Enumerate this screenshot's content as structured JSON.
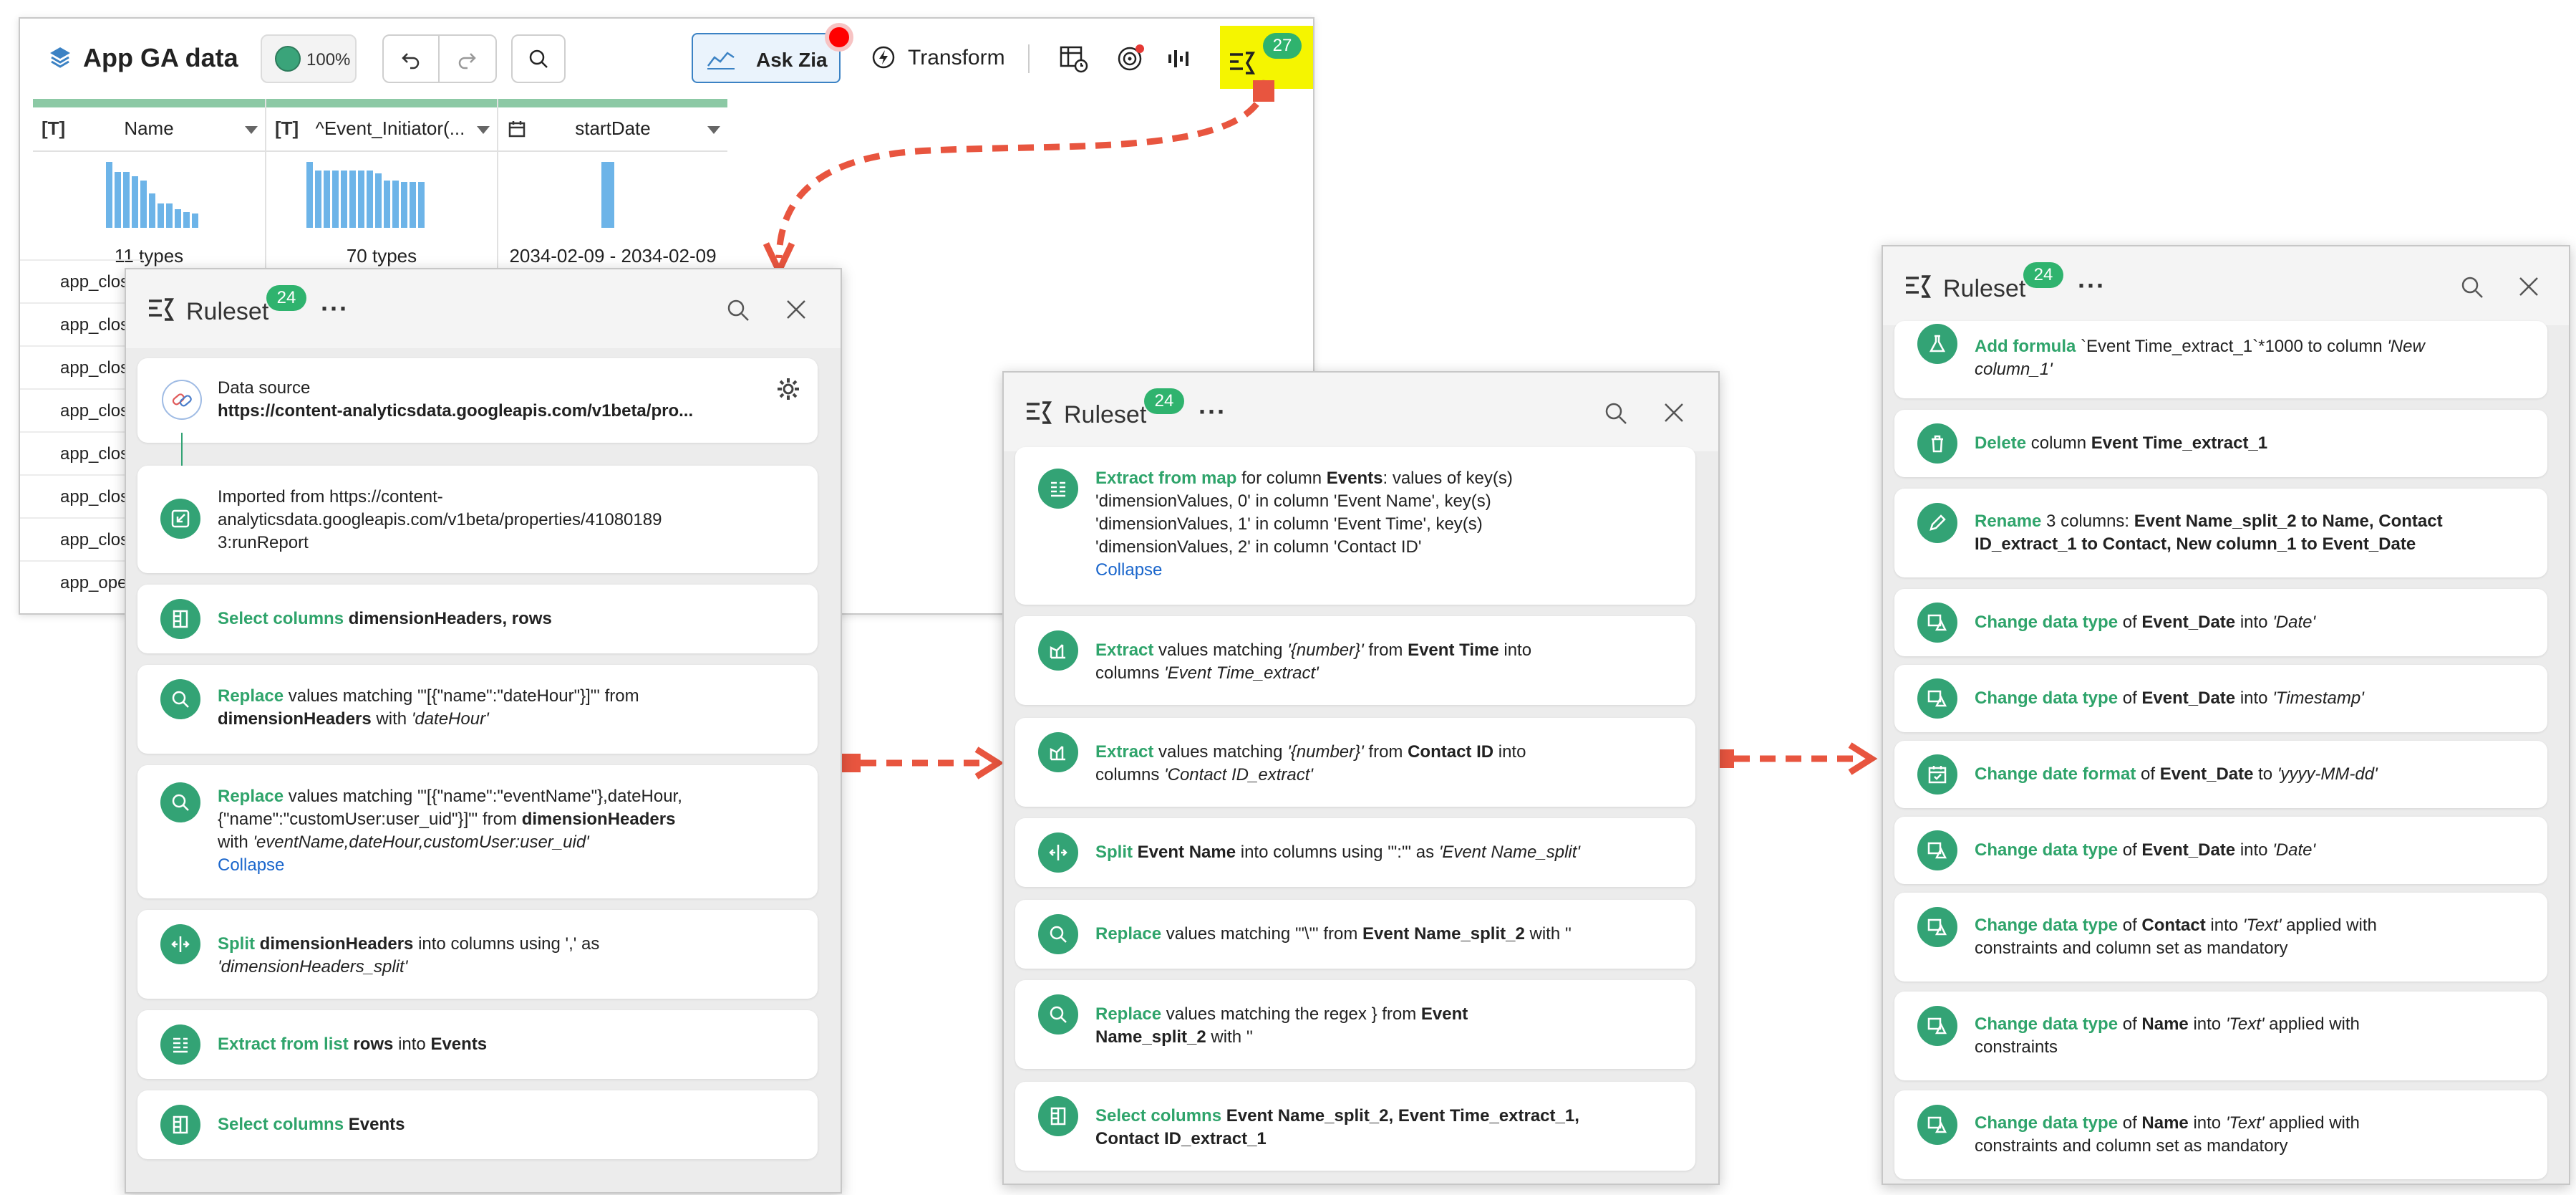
{
  "app": {
    "title": "App GA data",
    "zoom": "100%",
    "ask_zia_label": "Ask Zia",
    "transform_label": "Transform",
    "ruleset_badge": "27",
    "colors": {
      "accent_green": "#2fb36e",
      "action_green": "#2fa46b",
      "link_blue": "#1a66cc",
      "highlight_yellow": "#f5f500",
      "arrow_red": "#e8553f"
    },
    "columns": [
      {
        "type_icon": "[T]",
        "name": "Name",
        "summary": "11 types"
      },
      {
        "type_icon": "[T]",
        "name": "^Event_Initiator(...",
        "summary": "70 types"
      },
      {
        "type_icon": "calendar-icon",
        "name": "startDate",
        "summary": "2034-02-09 - 2034-02-09"
      }
    ],
    "rows": [
      "app_clos",
      "app_clos",
      "app_clos",
      "app_clos",
      "app_clos",
      "app_clos",
      "app_clos",
      "app_oper"
    ]
  },
  "panel1": {
    "title": "Ruleset",
    "badge": "24",
    "source": {
      "label": "Data source",
      "url": "https://content-analyticsdata.googleapis.com/v1beta/pro...",
      "imported_line1": "Imported from https://content-",
      "imported_line2": "analyticsdata.googleapis.com/v1beta/properties/41080189",
      "imported_line3": "3:runReport"
    },
    "steps": [
      {
        "action": "Select columns",
        "rest": "dimensionHeaders, rows"
      },
      {
        "action": "Replace",
        "t1": "values matching '\"[{\"name\":\"dateHour\"}]\"' from",
        "t2": "dimensionHeaders",
        "t3": "with",
        "t4": "'dateHour'"
      },
      {
        "action": "Replace",
        "t1": "values matching '\"[{\"name\":\"eventName\"},dateHour,",
        "t2": "{\"name\":\"customUser:user_uid\"}]\"' from",
        "t3": "dimensionHeaders",
        "t4": "with",
        "t5": "'eventName,dateHour,customUser:user_uid'",
        "collapse": "Collapse"
      },
      {
        "action": "Split",
        "t1": "dimensionHeaders",
        "t2": "into columns using ',' as",
        "t3": "'dimensionHeaders_split'"
      },
      {
        "action": "Extract from list",
        "t1": "rows",
        "t2": "into",
        "t3": "Events"
      },
      {
        "action": "Select columns",
        "rest": "Events"
      }
    ]
  },
  "panel2": {
    "title": "Ruleset",
    "badge": "24",
    "steps": [
      {
        "action": "Extract from map",
        "t1": "for column",
        "t2": "Events",
        "t3": ": values of key(s)",
        "l2": "'dimensionValues, 0' in column 'Event Name', key(s)",
        "l3": "'dimensionValues, 1' in column 'Event Time', key(s)",
        "l4": "'dimensionValues, 2' in column 'Contact ID'",
        "collapse": "Collapse"
      },
      {
        "action": "Extract",
        "t1": "values matching",
        "t2": "'{number}'",
        "t3": "from",
        "t4": "Event Time",
        "t5": "into",
        "t6": "columns",
        "t7": "'Event Time_extract'"
      },
      {
        "action": "Extract",
        "t1": "values matching",
        "t2": "'{number}'",
        "t3": "from",
        "t4": "Contact ID",
        "t5": "into",
        "t6": "columns",
        "t7": "'Contact ID_extract'"
      },
      {
        "action": "Split",
        "t1": "Event Name",
        "t2": "into columns using '\":\"' as",
        "t3": "'Event Name_split'"
      },
      {
        "action": "Replace",
        "t1": "values matching '\"\\\"' from",
        "t2": "Event Name_split_2",
        "t3": "with ''"
      },
      {
        "action": "Replace",
        "t1": "values matching the regex } from",
        "t2": "Event",
        "t3": "Name_split_2",
        "t4": "with ''"
      },
      {
        "action": "Select columns",
        "t1": "Event Name_split_2, Event Time_extract_1,",
        "t2": "Contact ID_extract_1"
      }
    ]
  },
  "panel3": {
    "title": "Ruleset",
    "badge": "24",
    "steps": [
      {
        "action": "Add formula",
        "t1": "`Event Time_extract_1`*1000 to column",
        "t2": "'New",
        "t3": "column_1'"
      },
      {
        "action": "Delete",
        "t1": "column",
        "t2": "Event Time_extract_1"
      },
      {
        "action": "Rename",
        "t1": "3 columns:",
        "t2": "Event Name_split_2 to Name, Contact",
        "t3": "ID_extract_1 to Contact, New column_1 to Event_Date"
      },
      {
        "action": "Change data type",
        "t1": "of",
        "t2": "Event_Date",
        "t3": "into",
        "t4": "'Date'"
      },
      {
        "action": "Change data type",
        "t1": "of",
        "t2": "Event_Date",
        "t3": "into",
        "t4": "'Timestamp'"
      },
      {
        "action": "Change date format",
        "t1": "of",
        "t2": "Event_Date",
        "t3": "to",
        "t4": "'yyyy-MM-dd'"
      },
      {
        "action": "Change data type",
        "t1": "of",
        "t2": "Event_Date",
        "t3": "into",
        "t4": "'Date'"
      },
      {
        "action": "Change data type",
        "t1": "of",
        "t2": "Contact",
        "t3": "into",
        "t4": "'Text'",
        "t5": "applied with",
        "l2": "constraints and column set as mandatory"
      },
      {
        "action": "Change data type",
        "t1": "of",
        "t2": "Name",
        "t3": "into",
        "t4": "'Text'",
        "t5": "applied with",
        "l2": "constraints"
      },
      {
        "action": "Change data type",
        "t1": "of",
        "t2": "Name",
        "t3": "into",
        "t4": "'Text'",
        "t5": "applied with",
        "l2": "constraints and column set as mandatory"
      }
    ]
  }
}
